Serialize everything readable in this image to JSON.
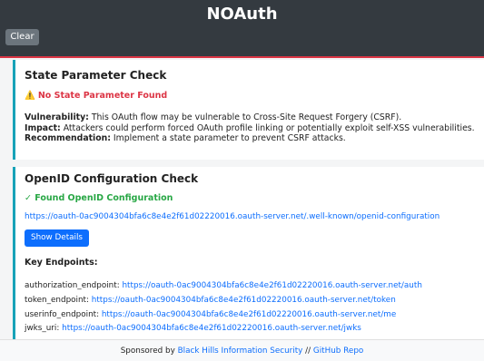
{
  "header": {
    "title": "NOAuth",
    "clear_label": "Clear"
  },
  "state_check": {
    "title": "State Parameter Check",
    "status": "No State Parameter Found",
    "vulnerability_label": "Vulnerability:",
    "vulnerability_text": "This OAuth flow may be vulnerable to Cross-Site Request Forgery (CSRF).",
    "impact_label": "Impact:",
    "impact_text": "Attackers could perform forced OAuth profile linking or potentially exploit self-XSS vulnerabilities.",
    "recommendation_label": "Recommendation:",
    "recommendation_text": "Implement a state parameter to prevent CSRF attacks."
  },
  "openid_check": {
    "title": "OpenID Configuration Check",
    "status": "Found OpenID Configuration",
    "config_url": "https://oauth-0ac9004304bfa6c8e4e2f61d02220016.oauth-server.net/.well-known/openid-configuration",
    "details_button": "Show Details",
    "endpoints_title": "Key Endpoints:",
    "endpoints": [
      {
        "label": "authorization_endpoint:",
        "url": "https://oauth-0ac9004304bfa6c8e4e2f61d02220016.oauth-server.net/auth"
      },
      {
        "label": "token_endpoint:",
        "url": "https://oauth-0ac9004304bfa6c8e4e2f61d02220016.oauth-server.net/token"
      },
      {
        "label": "userinfo_endpoint:",
        "url": "https://oauth-0ac9004304bfa6c8e4e2f61d02220016.oauth-server.net/me"
      },
      {
        "label": "jwks_uri:",
        "url": "https://oauth-0ac9004304bfa6c8e4e2f61d02220016.oauth-server.net/jwks"
      }
    ]
  },
  "footer": {
    "sponsored_prefix": "Sponsored by",
    "sponsor_link": "Black Hills Information Security",
    "separator": "//",
    "repo_link": "GitHub Repo"
  },
  "icons": {
    "warning": "warning-icon",
    "check": "check-icon"
  },
  "colors": {
    "header_bg": "#343a40",
    "accent_border": "#17a2b8",
    "error": "#dc3545",
    "success": "#28a745",
    "link": "#0d6efd"
  }
}
